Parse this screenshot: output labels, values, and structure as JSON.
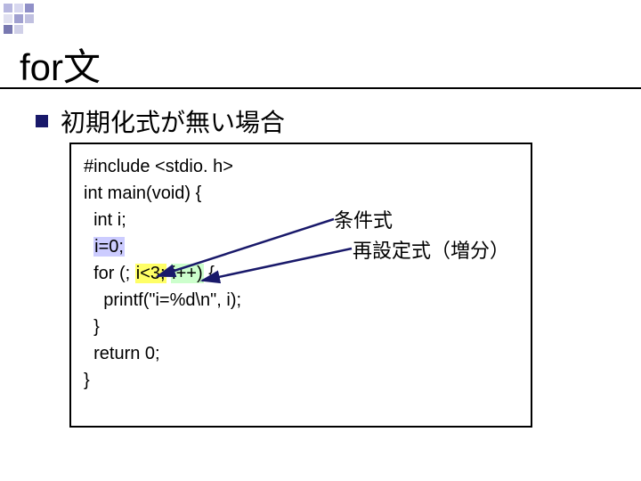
{
  "decoration": {
    "colors": [
      "#a8a8d0",
      "#6666a8",
      "#c8c8e8",
      "#9090c0",
      "#d8d8f0",
      "#b0b0d8"
    ]
  },
  "title": "for文",
  "bullet": {
    "text": "初期化式が無い場合"
  },
  "code": {
    "line1": "#include <stdio. h>",
    "line2": "",
    "line3": "int main(void) {",
    "line4_pre": "  int i;",
    "line5_pre": "  ",
    "line5_init": "i=0;",
    "line6_pre": "  for (; ",
    "line6_cond": "i<3;",
    "line6_mid": " ",
    "line6_inc": "i++)",
    "line6_post": " {",
    "line7": "    printf(\"i=%d\\n\", i);",
    "line8": "  }",
    "line9": "  return 0;",
    "line10": "}"
  },
  "annotations": {
    "cond": "条件式",
    "inc": "再設定式（増分）"
  }
}
